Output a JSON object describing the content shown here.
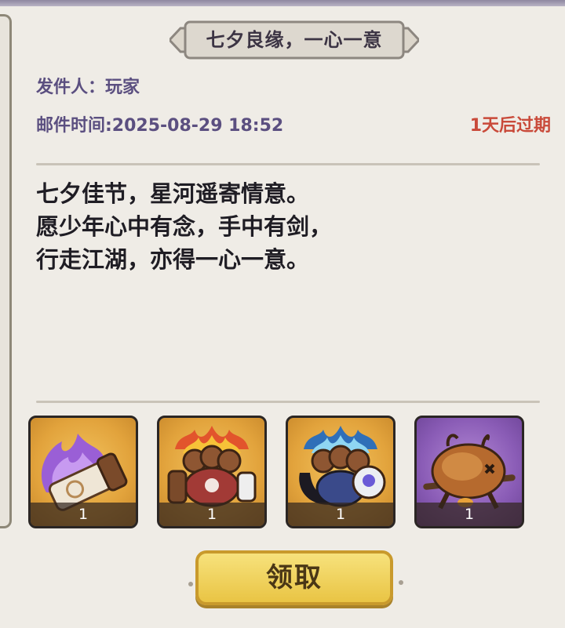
{
  "mail": {
    "title": "七夕良缘，一心一意",
    "sender": "发件人：玩家",
    "time": "邮件时间:2025-08-29 18:52",
    "expiry": "1天后过期",
    "body_lines": [
      "七夕佳节，星河遥寄情意。",
      "愿少年心中有念，手中有剑，",
      "行走江湖，亦得一心一意。"
    ]
  },
  "rewards": [
    {
      "icon": "purple-flame-scroll-icon",
      "count": "1",
      "frame": "orange"
    },
    {
      "icon": "fire-crab-creature-icon",
      "count": "1",
      "frame": "orange"
    },
    {
      "icon": "ice-crab-creature-icon",
      "count": "1",
      "frame": "orange"
    },
    {
      "icon": "roast-boar-icon",
      "count": "1",
      "frame": "purple"
    }
  ],
  "claim_button": {
    "label": "领取"
  },
  "colors": {
    "sender_text": "#5b4f80",
    "expiry_text": "#c94a3a",
    "button_fill": "#f0d35c",
    "item_orange": "#e2a33c",
    "item_purple": "#8a5cb6"
  }
}
